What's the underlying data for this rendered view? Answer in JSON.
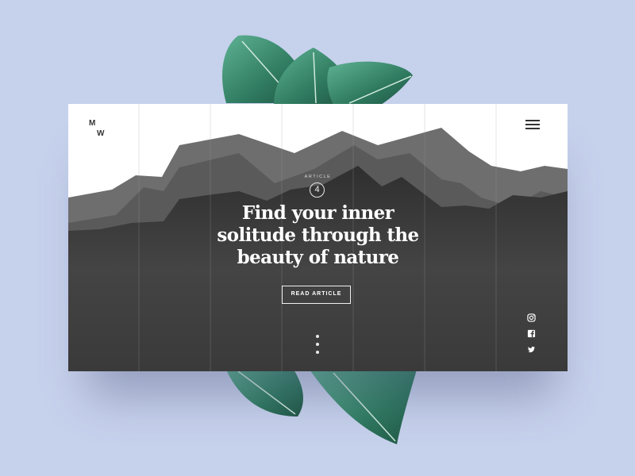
{
  "logo": {
    "line1": "M",
    "line2": "W"
  },
  "header": {
    "menu_icon": "hamburger-menu-icon"
  },
  "article": {
    "label": "ARTICLE",
    "number": "4",
    "headline": [
      "Find your inner",
      "solitude through the",
      "beauty of nature"
    ],
    "cta_label": "READ ARTICLE"
  },
  "pagination": {
    "dot_count": 3,
    "icon": "vertical-dots-icon"
  },
  "social": [
    "instagram-icon",
    "facebook-icon",
    "twitter-icon"
  ],
  "colors": {
    "background": "#c6d1ec",
    "card": "#ffffff",
    "mountain_far": "#6e6e6e",
    "mountain_mid": "#5a5a5a",
    "mountain_near": "#3a3a3a",
    "leaf": "#3f8a6f",
    "text_light": "#ffffff"
  }
}
